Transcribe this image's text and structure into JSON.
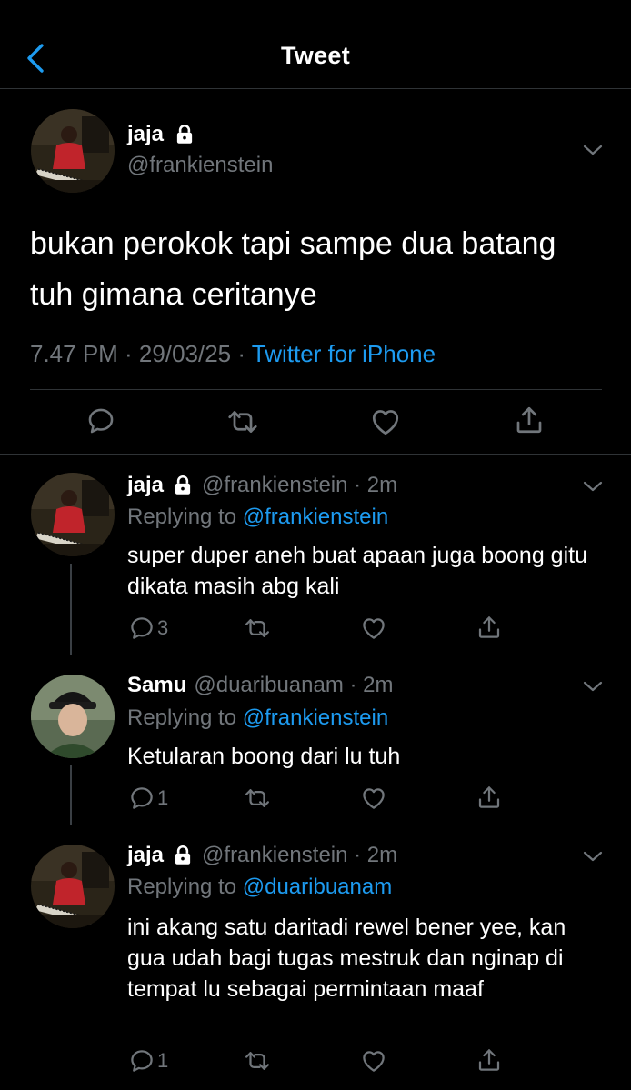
{
  "header": {
    "title": "Tweet"
  },
  "main_tweet": {
    "name": "jaja",
    "handle": "@frankienstein",
    "text": "bukan perokok tapi sampe dua batang tuh gimana ceritanye",
    "time_date": "7.47 PM · 29/03/25 · ",
    "source": "Twitter for iPhone"
  },
  "replies": [
    {
      "name": "jaja",
      "handle_time": "@frankienstein · 2m",
      "replying_prefix": "Replying to",
      "replying_to": "@frankienstein",
      "text": "super duper aneh buat apaan juga boong gitu dikata masih abg kali",
      "reply_count": "3"
    },
    {
      "name": "Samu",
      "handle_time": "@duaribuanam · 2m",
      "replying_prefix": "Replying to",
      "replying_to": "@frankienstein",
      "text": "Ketularan boong dari lu tuh",
      "reply_count": "1"
    },
    {
      "name": "jaja",
      "handle_time": "@frankienstein · 2m",
      "replying_prefix": "Replying to",
      "replying_to": "@duaribuanam",
      "text": "ini akang satu daritadi rewel bener yee, kan gua udah bagi tugas mestruk dan nginap di tempat lu sebagai permintaan maaf",
      "reply_count": "1"
    }
  ],
  "colors": {
    "accent": "#1d9bf0",
    "secondary_text": "#71767b",
    "divider": "#2f3336"
  },
  "icons": [
    "back-chevron-icon",
    "lock-icon",
    "chevron-down-icon",
    "reply-icon",
    "retweet-icon",
    "like-icon",
    "share-icon"
  ]
}
